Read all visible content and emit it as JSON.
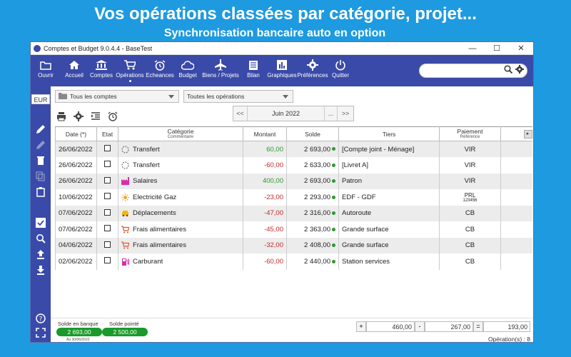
{
  "banner": {
    "line1": "Vos opérations classées par catégorie, projet...",
    "line2": "Synchronisation bancaire auto en option"
  },
  "window": {
    "title": "Comptes et Budget 9.0.4.4 - BaseTest",
    "minimize": "—",
    "maximize": "☐",
    "close": "✕"
  },
  "toolbar": {
    "items": [
      {
        "label": "Ouvrir",
        "icon": "folder-icon"
      },
      {
        "label": "Accueil",
        "icon": "home-icon"
      },
      {
        "label": "Comptes",
        "icon": "bank-icon"
      },
      {
        "label": "Opérations",
        "icon": "cart-icon"
      },
      {
        "label": "Echeances",
        "icon": "alarm-icon"
      },
      {
        "label": "Budget",
        "icon": "cloud-icon"
      },
      {
        "label": "Biens / Projets",
        "icon": "plane-icon"
      },
      {
        "label": "Bilan",
        "icon": "document-icon"
      },
      {
        "label": "Graphiques",
        "icon": "chart-icon"
      },
      {
        "label": "Préférences",
        "icon": "gear-icon"
      },
      {
        "label": "Quitter",
        "icon": "power-icon"
      }
    ],
    "search_value": ""
  },
  "sidebar": {
    "currency": "EUR"
  },
  "filters": {
    "account": "Tous les comptes",
    "operations": "Toutes les opérations"
  },
  "month_nav": {
    "prev": "<<",
    "month": "Juin 2022",
    "picker": "...",
    "next": ">>"
  },
  "table": {
    "headers": {
      "date": "Date (*)",
      "etat": "Etat",
      "categorie": "Catégorie",
      "commentaire": "Commentaire",
      "montant": "Montant",
      "solde": "Solde",
      "tiers": "Tiers",
      "paiement": "Paiement",
      "reference": "Référence"
    },
    "rows": [
      {
        "date": "26/06/2022",
        "categorie": "Transfert",
        "montant": "60,00",
        "solde": "2 693,00",
        "tiers": "[Compte joint - Ménage]",
        "paiement": "VIR",
        "ref": ""
      },
      {
        "date": "26/06/2022",
        "categorie": "Transfert",
        "montant": "-60,00",
        "solde": "2 633,00",
        "tiers": "[Livret A]",
        "paiement": "VIR",
        "ref": ""
      },
      {
        "date": "26/06/2022",
        "categorie": "Salaires",
        "montant": "400,00",
        "solde": "2 693,00",
        "tiers": "Patron",
        "paiement": "VIR",
        "ref": ""
      },
      {
        "date": "10/06/2022",
        "categorie": "Electricité Gaz",
        "montant": "-23,00",
        "solde": "2 293,00",
        "tiers": "EDF - GDF",
        "paiement": "PRL",
        "ref": "123456"
      },
      {
        "date": "07/06/2022",
        "categorie": "Déplacements",
        "montant": "-47,00",
        "solde": "2 316,00",
        "tiers": "Autoroute",
        "paiement": "CB",
        "ref": ""
      },
      {
        "date": "07/06/2022",
        "categorie": "Frais alimentaires",
        "montant": "-45,00",
        "solde": "2 363,00",
        "tiers": "Grande surface",
        "paiement": "CB",
        "ref": ""
      },
      {
        "date": "04/06/2022",
        "categorie": "Frais alimentaires",
        "montant": "-32,00",
        "solde": "2 408,00",
        "tiers": "Grande surface",
        "paiement": "CB",
        "ref": ""
      },
      {
        "date": "02/06/2022",
        "categorie": "Carburant",
        "montant": "-60,00",
        "solde": "2 440,00",
        "tiers": "Station services",
        "paiement": "CB",
        "ref": ""
      }
    ]
  },
  "footer": {
    "solde_banque_label": "Solde en banque",
    "solde_banque": "2 693,00",
    "solde_banque_note": "Au 30/06/2022",
    "solde_pointe_label": "Solde pointé",
    "solde_pointe": "2 500,00",
    "plus_sign": "+",
    "credits": "460,00",
    "minus_sign": "-",
    "debits": "267,00",
    "equals_sign": "=",
    "total": "193,00",
    "op_count": "Opération(s) : 8"
  }
}
